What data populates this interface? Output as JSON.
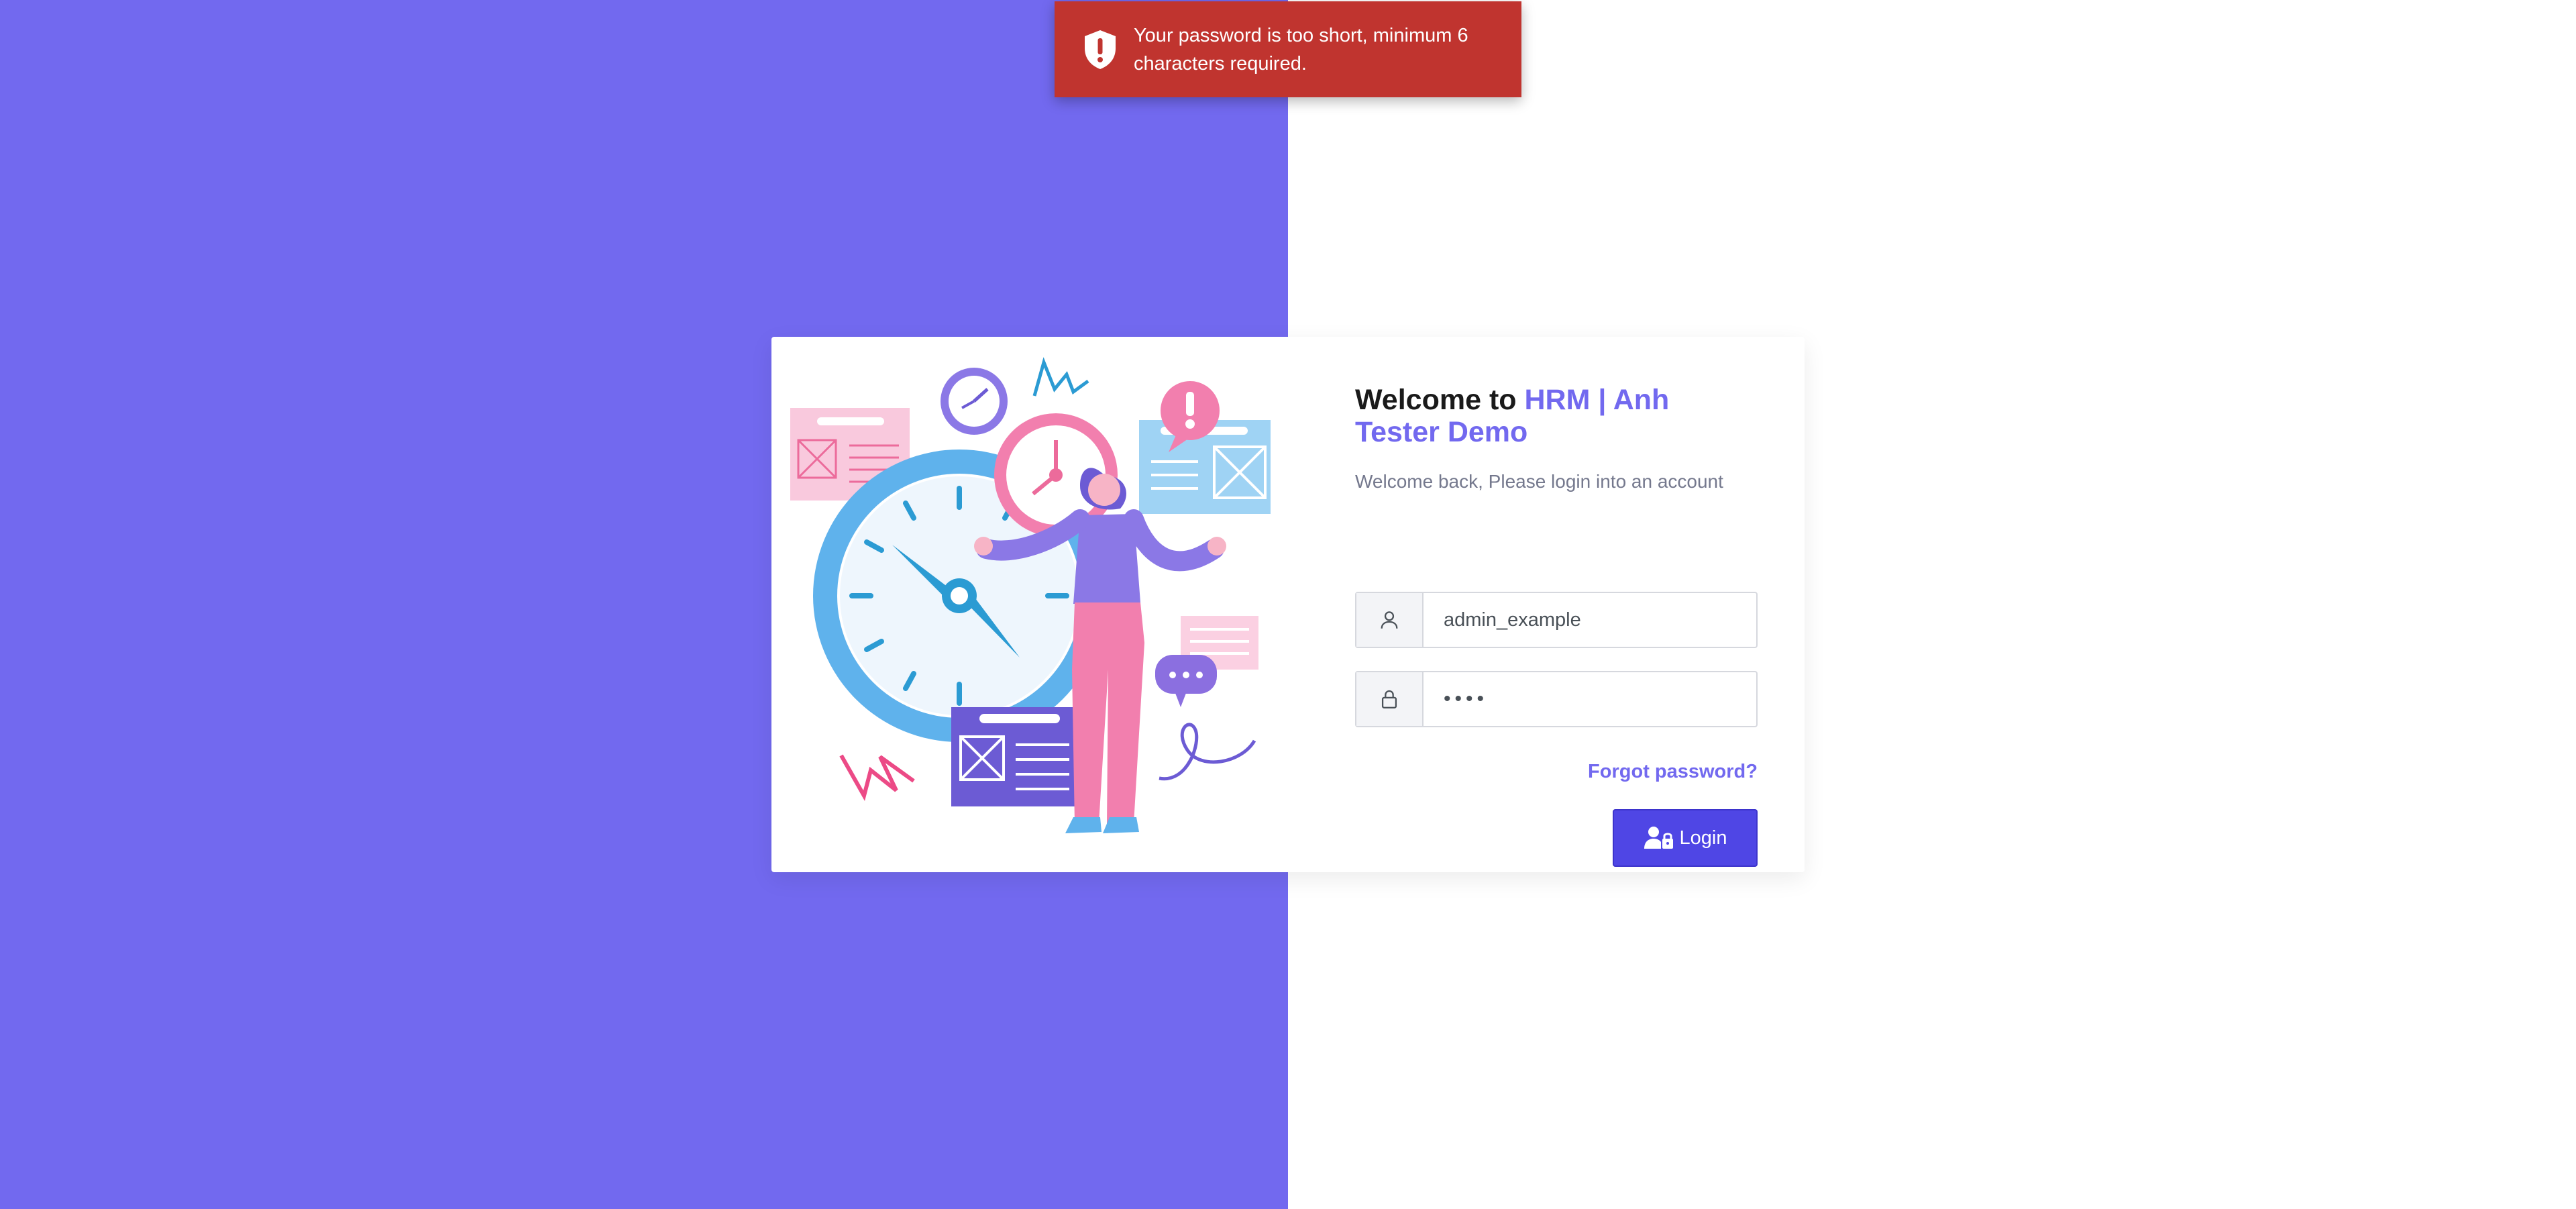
{
  "toast": {
    "message": "Your password is too short, minimum 6 characters required.",
    "icon": "shield-alert-icon",
    "color": "#c0342f"
  },
  "login": {
    "title_prefix": "Welcome to",
    "title_brand": "HRM | Anh Tester Demo",
    "subtitle": "Welcome back, Please login into an account",
    "username_value": "admin_example",
    "password_value": "••••",
    "forgot_label": "Forgot password?",
    "login_label": "Login"
  },
  "colors": {
    "left_panel": "#7269ef",
    "brand": "#7269ef",
    "button": "#4f46e5"
  }
}
